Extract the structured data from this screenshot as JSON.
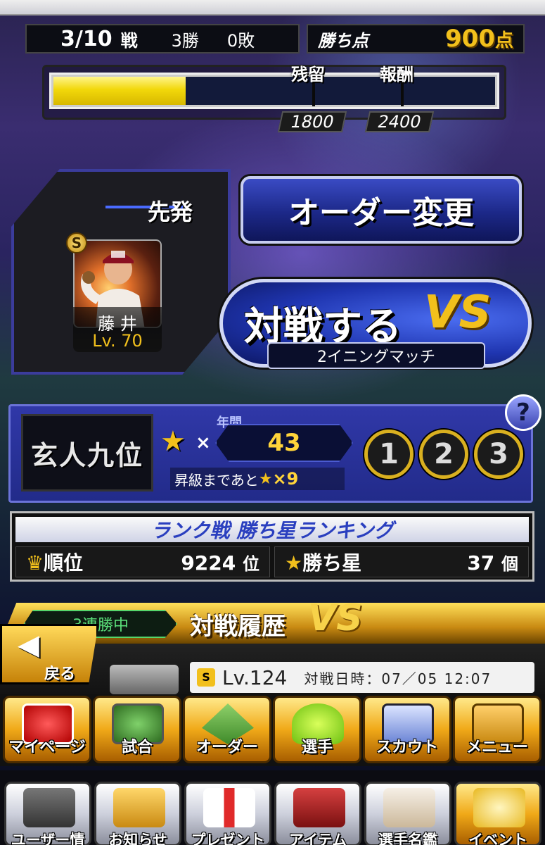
{
  "header": {
    "battle_count": "3/10",
    "battle_unit": "戦",
    "wins": "3勝",
    "losses": "0敗",
    "points_label": "勝ち点",
    "points_value": "900",
    "points_unit": "点"
  },
  "progress": {
    "fill_fraction": 0.3,
    "marker1_label": "残留",
    "marker1_value": "1800",
    "marker2_label": "報酬",
    "marker2_value": "2400"
  },
  "starter": {
    "title": "先発",
    "player_name": "藤 井",
    "level": "Lv. 70",
    "rarity": "S"
  },
  "actions": {
    "order_change": "オーダー変更",
    "battle": "対戦する",
    "battle_vs": "VS",
    "battle_sub": "2イニングマッチ"
  },
  "rank": {
    "rank_name": "玄人九位",
    "annual_label": "年間",
    "star_times": "×",
    "star_count": "43",
    "promotion_text": "昇級まであと",
    "promotion_count": "×9",
    "circles": [
      "1",
      "2",
      "3"
    ],
    "help": "?"
  },
  "ranking": {
    "title": "ランク戦 勝ち星ランキング",
    "position_label": "順位",
    "position_value": "9224",
    "position_unit": "位",
    "wins_label": "勝ち星",
    "wins_value": "37",
    "wins_unit": "個"
  },
  "history": {
    "streak": "3連勝中",
    "title": "対戦履歴",
    "back": "戻る",
    "opponent_level": "Lv.124",
    "opponent_date_label": "対戦日時：",
    "opponent_date": "07／05 12:07"
  },
  "nav_main": [
    {
      "label": "マイページ",
      "icon": "a-logo-icon"
    },
    {
      "label": "試合",
      "icon": "stadium-icon"
    },
    {
      "label": "オーダー",
      "icon": "field-icon"
    },
    {
      "label": "選手",
      "icon": "player-icon"
    },
    {
      "label": "スカウト",
      "icon": "scout-card-icon"
    },
    {
      "label": "メニュー",
      "icon": "menu-box-icon"
    }
  ],
  "nav_sub": [
    {
      "label": "ユーザー情報",
      "icon": "user-card-icon"
    },
    {
      "label": "お知らせ",
      "icon": "notice-icon"
    },
    {
      "label": "プレゼント",
      "icon": "gift-icon"
    },
    {
      "label": "アイテム",
      "icon": "item-book-icon"
    },
    {
      "label": "選手名鑑",
      "icon": "player-book-icon"
    },
    {
      "label": "イベント",
      "icon": "event-ball-icon"
    }
  ],
  "colors": {
    "accent_gold": "#f2c01c",
    "progress_fill": "#f2d80a",
    "panel_blue": "#2a3396",
    "streak_green": "#5be07a"
  }
}
